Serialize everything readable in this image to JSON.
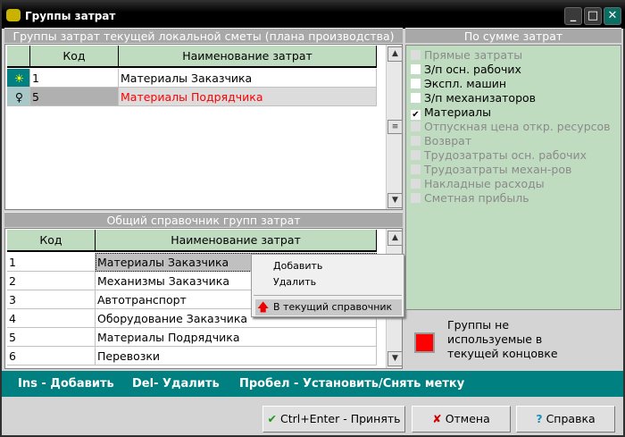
{
  "window": {
    "title": "Группы затрат",
    "minimize": "_",
    "maximize": "□",
    "close": "✕"
  },
  "current": {
    "header": "Группы затрат текущей локальной сметы (плана производства)",
    "columns": [
      "Код",
      "Наименование затрат"
    ],
    "rows": [
      {
        "code": "1",
        "name": "Материалы Заказчика",
        "icon": "lightbulb-on-icon"
      },
      {
        "code": "5",
        "name": "Материалы Подрядчика",
        "icon": "lightbulb-off-icon"
      }
    ]
  },
  "general": {
    "header": "Общий справочник групп затрат",
    "columns": [
      "Код",
      "Наименование затрат"
    ],
    "rows": [
      {
        "code": "1",
        "name": "Материалы Заказчика"
      },
      {
        "code": "2",
        "name": "Механизмы Заказчика"
      },
      {
        "code": "3",
        "name": "Автотранспорт"
      },
      {
        "code": "4",
        "name": "Оборудование Заказчика"
      },
      {
        "code": "5",
        "name": "Материалы Подрядчика"
      },
      {
        "code": "6",
        "name": "Перевозки"
      }
    ]
  },
  "context_menu": {
    "items": [
      "Добавить",
      "Удалить",
      "В текущий справочник"
    ]
  },
  "by_sum": {
    "header": "По сумме затрат",
    "items": [
      {
        "label": "Прямые затраты",
        "checked": false,
        "enabled": false
      },
      {
        "label": "З/п осн. рабочих",
        "checked": false,
        "enabled": true
      },
      {
        "label": "Экспл. машин",
        "checked": false,
        "enabled": true
      },
      {
        "label": "З/п механизаторов",
        "checked": false,
        "enabled": true
      },
      {
        "label": "Материалы",
        "checked": true,
        "enabled": true
      },
      {
        "label": "Отпускная цена откр. ресурсов",
        "checked": false,
        "enabled": false
      },
      {
        "label": "Возврат",
        "checked": false,
        "enabled": false
      },
      {
        "label": "Трудозатраты осн. рабочих",
        "checked": false,
        "enabled": false
      },
      {
        "label": "Трудозатраты механ-ров",
        "checked": false,
        "enabled": false
      },
      {
        "label": "Накладные расходы",
        "checked": false,
        "enabled": false
      },
      {
        "label": "Сметная прибыль",
        "checked": false,
        "enabled": false
      }
    ]
  },
  "legend": {
    "text": "Группы не используемые в текущей концовке",
    "color": "#ff0000"
  },
  "hotkeys": [
    "Ins - Добавить",
    "Del- Удалить",
    "Пробел - Установить/Снять метку"
  ],
  "buttons": {
    "accept": "Ctrl+Enter - Принять",
    "cancel": "Отмена",
    "help": "Справка"
  },
  "colors": {
    "teal": "#008080",
    "green": "#c0dcc0",
    "red": "#ff0000"
  }
}
